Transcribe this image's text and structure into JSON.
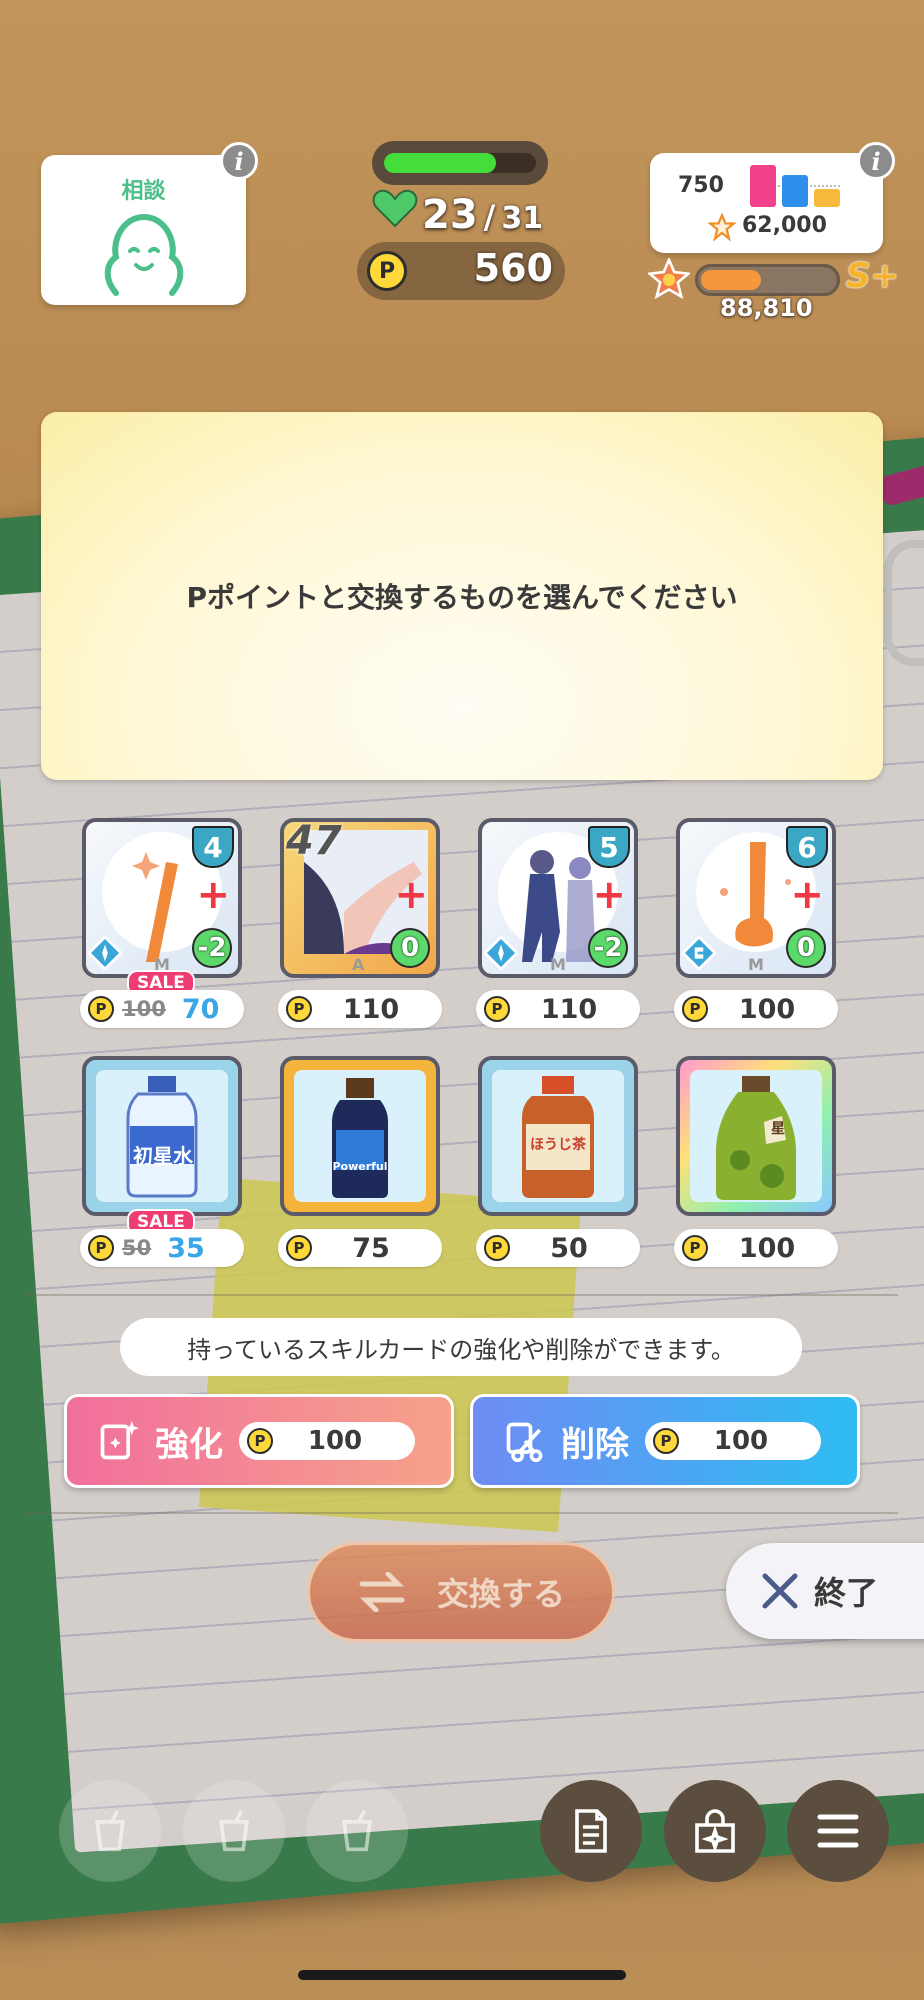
{
  "consult": {
    "label": "相談"
  },
  "stamina": {
    "current": "23",
    "separator": "/",
    "max": "31",
    "fill": 0.74
  },
  "points": {
    "coin": "P",
    "value": "560"
  },
  "stats": {
    "param": "750",
    "star_points": "62,000",
    "bar_colors": [
      "#f0418a",
      "#2e8fea",
      "#f6b93b"
    ]
  },
  "rank": {
    "score": "88,810",
    "grade": "S+",
    "fill": 0.45
  },
  "message": "Pポイントと交換するものを選んでください",
  "skill_cards": [
    {
      "badge": "4",
      "cost": "-2",
      "grade": "M",
      "sale": "SALE",
      "old_price": "100",
      "price": "70"
    },
    {
      "badge": "47",
      "cost": "0",
      "grade": "A",
      "price": "110"
    },
    {
      "badge": "5",
      "cost": "-2",
      "grade": "M",
      "price": "110"
    },
    {
      "badge": "6",
      "cost": "0",
      "grade": "M",
      "price": "100"
    }
  ],
  "drinks": [
    {
      "label": "初星水",
      "sale": "SALE",
      "old_price": "50",
      "price": "35",
      "frame": "#9bd3ea"
    },
    {
      "label": "Powerful",
      "price": "75",
      "frame": "#f5b53d"
    },
    {
      "label": "ほうじ茶",
      "price": "50",
      "frame": "#9bd3ea"
    },
    {
      "label": "星",
      "price": "100",
      "frame": "rainbow"
    }
  ],
  "hint": "持っているスキルカードの強化や削除ができます。",
  "enhance": {
    "label": "強化",
    "price": "100"
  },
  "delete": {
    "label": "削除",
    "price": "100"
  },
  "exchange_label": "交換する",
  "exit_label": "終了",
  "colors": {
    "enhance": "#f16f9c",
    "delete": "#6f8cf4",
    "exchange": "#d87450",
    "accent_blue": "#3aa6e6"
  }
}
